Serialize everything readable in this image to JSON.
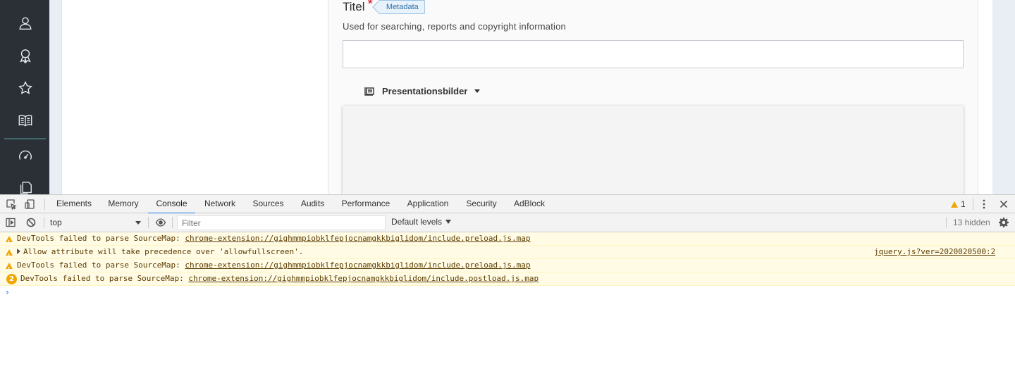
{
  "app": {
    "sidebar": {
      "icons": [
        "user-icon",
        "award-icon",
        "star-icon",
        "book-icon",
        "dashboard-icon",
        "documents-icon"
      ]
    },
    "field": {
      "title": "Titel",
      "required_mark": "*",
      "tag": "Metadata",
      "help": "Used for searching, reports and copyright information",
      "value": ""
    },
    "section": {
      "label": "Presentationsbilder"
    }
  },
  "devtools": {
    "tabs": [
      "Elements",
      "Memory",
      "Console",
      "Network",
      "Sources",
      "Audits",
      "Performance",
      "Application",
      "Security",
      "AdBlock"
    ],
    "active_tab": "Console",
    "warning_count": "1",
    "toolbar": {
      "context": "top",
      "filter_placeholder": "Filter",
      "levels": "Default levels",
      "hidden": "13 hidden"
    },
    "messages": [
      {
        "text": "DevTools failed to parse SourceMap: ",
        "link": "chrome-extension://gighmmpiobklfepjocnamgkkbiglidom/include.preload.js.map",
        "source": "",
        "badge": ""
      },
      {
        "text": "Allow attribute will take precedence over 'allowfullscreen'.",
        "link": "",
        "source": "jquery.js?ver=2020020500:2",
        "badge": ""
      },
      {
        "text": "DevTools failed to parse SourceMap: ",
        "link": "chrome-extension://gighmmpiobklfepjocnamgkkbiglidom/include.preload.js.map",
        "source": "",
        "badge": ""
      },
      {
        "text": "DevTools failed to parse SourceMap: ",
        "link": "chrome-extension://gighmmpiobklfepjocnamgkkbiglidom/include.postload.js.map",
        "source": "",
        "badge": "2"
      }
    ],
    "prompt": "›",
    "colors": {
      "warning_bg": "#fffbe5",
      "warning_icon": "#f2a600",
      "active_tab_underline": "#1a73e8"
    }
  }
}
